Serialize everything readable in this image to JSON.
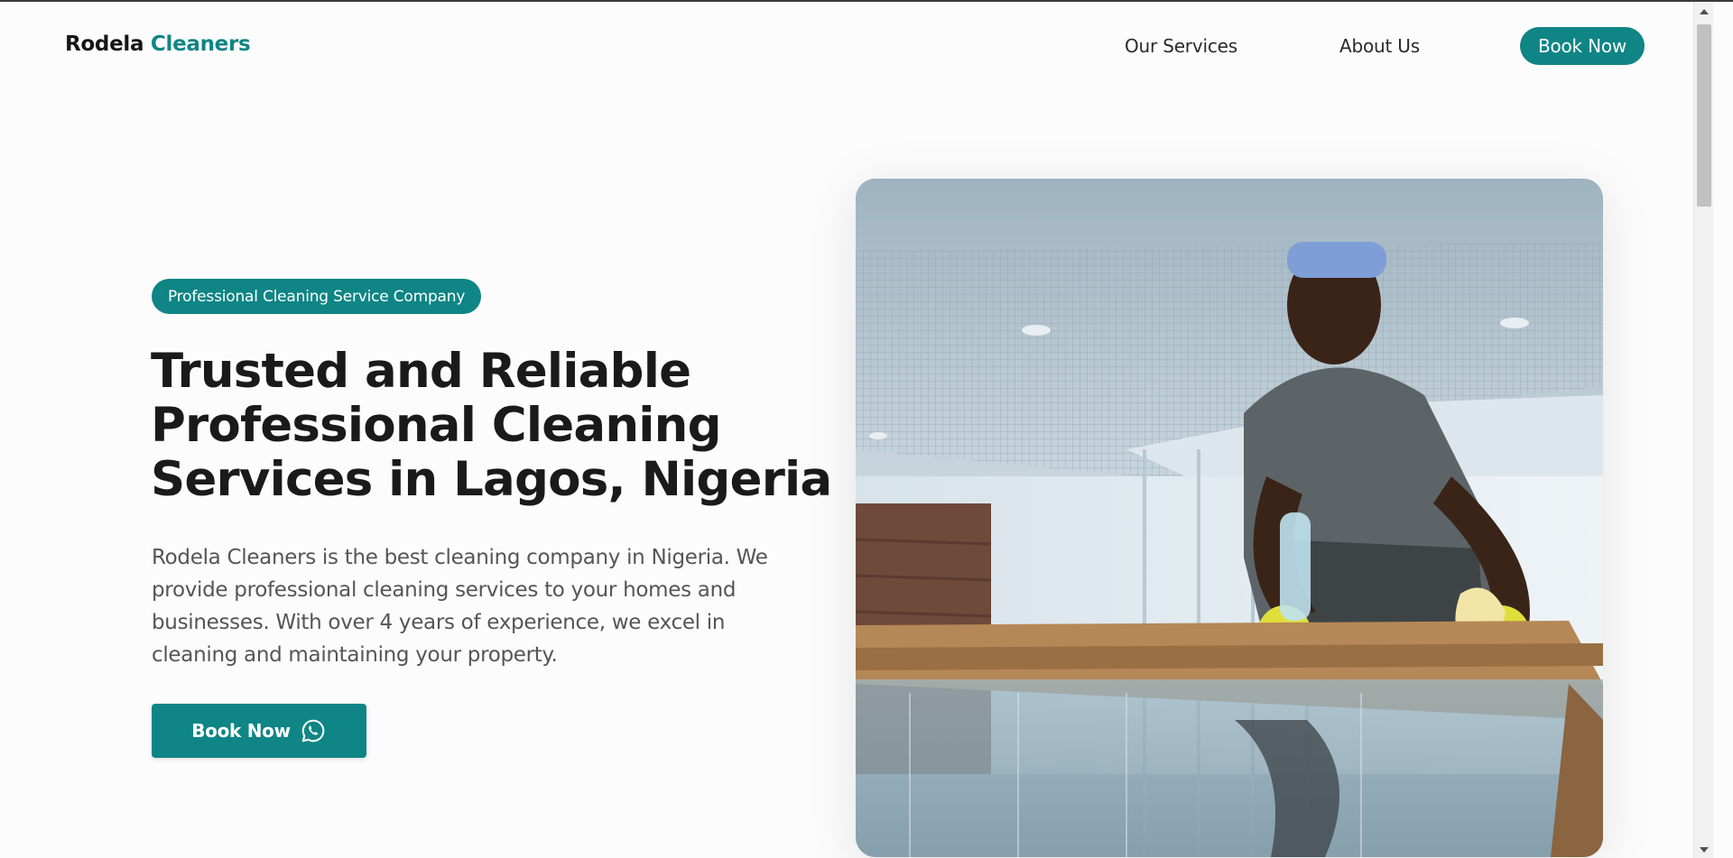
{
  "header": {
    "brand_part1": "Rodela",
    "brand_part2": "Cleaners",
    "nav": {
      "services": "Our Services",
      "about": "About Us",
      "book": "Book Now"
    }
  },
  "hero": {
    "badge": "Professional Cleaning Service Company",
    "headline_lines": [
      "Trusted and Reliable",
      "Professional Cleaning",
      "Services in Lagos, Nigeria"
    ],
    "lead_lines": [
      "Rodela Cleaners is the best cleaning company in Nigeria. We",
      "provide professional cleaning services to your homes and",
      "businesses. With over 4 years of experience, we excel in",
      "cleaning and maintaining your property."
    ],
    "cta_label": "Book Now",
    "cta_icon": "whatsapp-icon"
  },
  "colors": {
    "accent": "#0f8585",
    "text_dark": "#1a1a1a",
    "text_muted": "#555555"
  }
}
